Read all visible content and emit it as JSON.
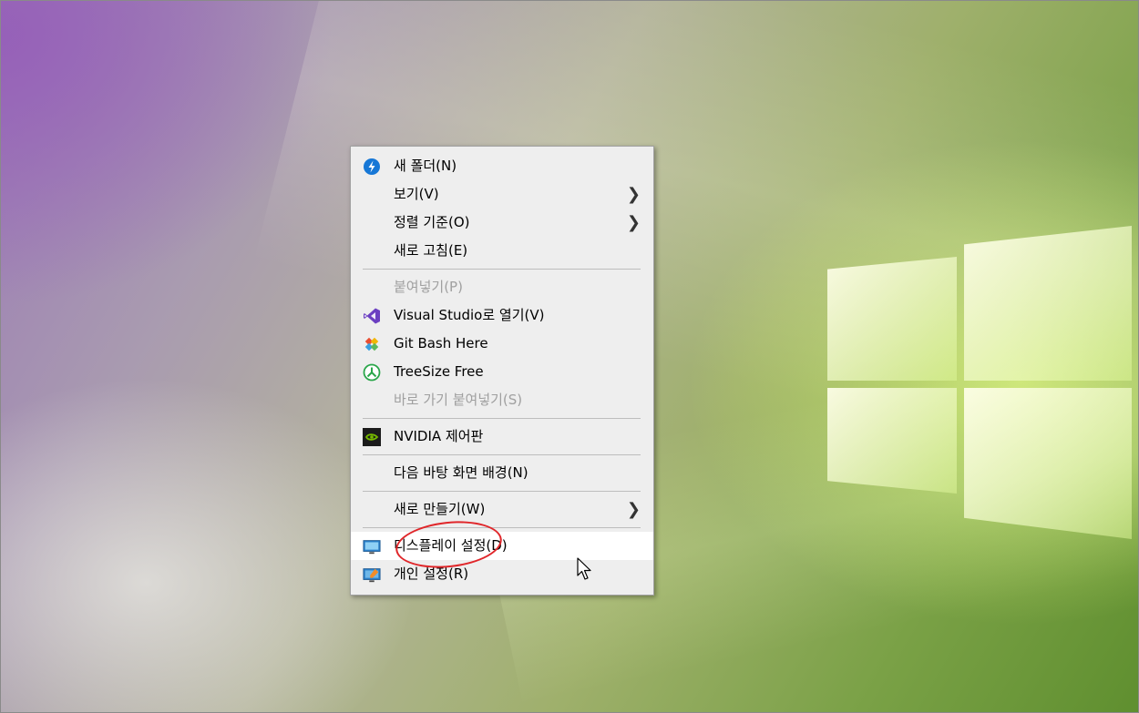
{
  "context_menu": {
    "items": [
      {
        "label": "새 폴더(N)",
        "icon": "new-folder-icon",
        "type": "item"
      },
      {
        "label": "보기(V)",
        "icon": "",
        "type": "submenu"
      },
      {
        "label": "정렬 기준(O)",
        "icon": "",
        "type": "submenu"
      },
      {
        "label": "새로 고침(E)",
        "icon": "",
        "type": "item"
      },
      {
        "label": "붙여넣기(P)",
        "icon": "",
        "type": "disabled"
      },
      {
        "label": "Visual Studio로 열기(V)",
        "icon": "visual-studio-icon",
        "type": "item"
      },
      {
        "label": "Git Bash Here",
        "icon": "git-bash-icon",
        "type": "item"
      },
      {
        "label": "TreeSize Free",
        "icon": "treesize-icon",
        "type": "item"
      },
      {
        "label": "바로 가기 붙여넣기(S)",
        "icon": "",
        "type": "disabled"
      },
      {
        "label": "NVIDIA 제어판",
        "icon": "nvidia-icon",
        "type": "item"
      },
      {
        "label": "다음 바탕 화면 배경(N)",
        "icon": "",
        "type": "item"
      },
      {
        "label": "새로 만들기(W)",
        "icon": "",
        "type": "submenu"
      },
      {
        "label": "디스플레이 설정(D)",
        "icon": "display-settings-icon",
        "type": "hover"
      },
      {
        "label": "개인 설정(R)",
        "icon": "personalize-icon",
        "type": "item"
      }
    ],
    "submenu_arrow": "❯"
  },
  "colors": {
    "menu_background": "#eeeeee",
    "highlight_oval": "#e0262a",
    "disabled_text": "#a0a0a0"
  }
}
